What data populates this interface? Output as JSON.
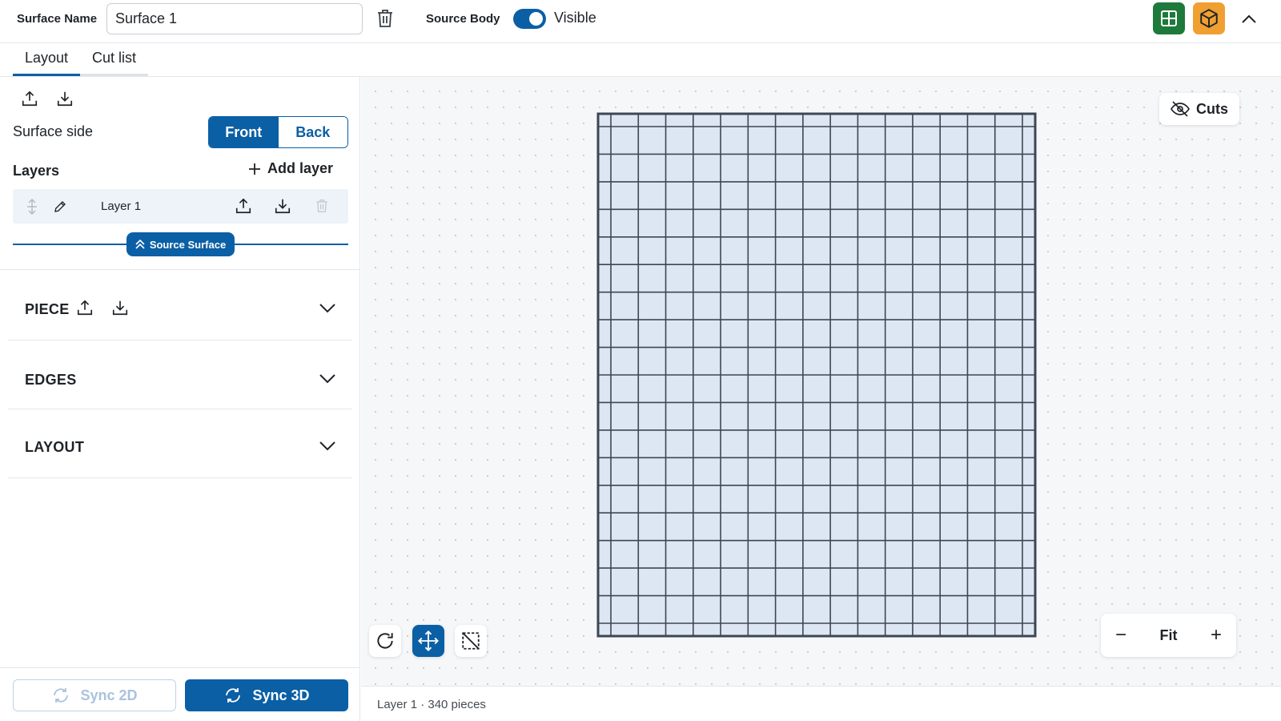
{
  "header": {
    "surface_name_label": "Surface Name",
    "surface_name_value": "Surface 1",
    "source_body_label": "Source Body",
    "visibility_label": "Visible",
    "visibility_on": true,
    "grid_button_color": "#1d7a3a",
    "box_button_color": "#f0a030"
  },
  "tabs": [
    {
      "label": "Layout",
      "active": true
    },
    {
      "label": "Cut list",
      "active": false
    }
  ],
  "panel": {
    "surface_side_label": "Surface side",
    "side_options": [
      "Front",
      "Back"
    ],
    "selected_side": "Front",
    "layers_label": "Layers",
    "add_layer_label": "Add layer",
    "layers": [
      {
        "name": "Layer 1"
      }
    ],
    "source_surface_label": "Source Surface",
    "sections": [
      {
        "title": "PIECE",
        "has_io": true
      },
      {
        "title": "EDGES",
        "has_io": false
      },
      {
        "title": "LAYOUT",
        "has_io": false
      }
    ],
    "sync2d_label": "Sync 2D",
    "sync3d_label": "Sync 3D"
  },
  "canvas": {
    "cuts_label": "Cuts",
    "zoom_fit_label": "Fit",
    "zoom_out_symbol": "−",
    "zoom_in_symbol": "+",
    "grid_columns": 16,
    "grid_rows": 19,
    "tile_color": "#dde6f3",
    "line_color": "#3e4653"
  },
  "status": {
    "text": "Layer 1 · 340 pieces"
  },
  "colors": {
    "accent": "#0b5fa5"
  }
}
